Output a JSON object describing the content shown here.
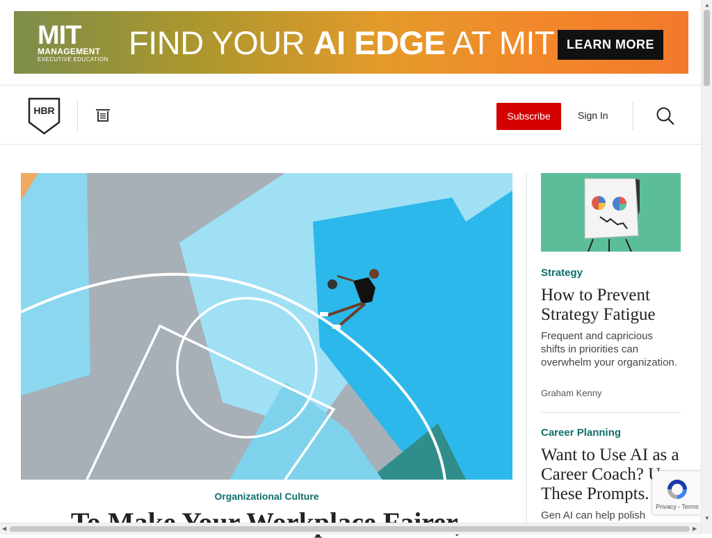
{
  "ad": {
    "logo_mit": "MIT",
    "logo_management": "MANAGEMENT",
    "logo_exec": "EXECUTIVE EDUCATION",
    "headline_prefix": "FIND YOUR ",
    "headline_bold": "AI EDGE",
    "headline_suffix": " AT MIT",
    "cta": "LEARN MORE"
  },
  "header": {
    "logo_text": "HBR",
    "subscribe_label": "Subscribe",
    "signin_label": "Sign In",
    "accent_color": "#d50000"
  },
  "main_article": {
    "category": "Organizational Culture",
    "title": "To Make Your Workplace Fairer,"
  },
  "sidebar": {
    "articles": [
      {
        "category": "Strategy",
        "title": "How to Prevent Strategy Fatigue",
        "description": "Frequent and capricious shifts in priorities can overwhelm your organization.",
        "author": "Graham Kenny"
      },
      {
        "category": "Career Planning",
        "title": "Want to Use AI as a Career Coach? Use These Prompts.",
        "description": "Gen AI can help polish"
      }
    ]
  },
  "recaptcha": {
    "terms_text": "Privacy - Terms"
  },
  "icons": {
    "menu": "menu-icon",
    "search": "search-icon"
  },
  "colors": {
    "category_teal": "#0f6e6e",
    "thumb_green": "#5bbe98"
  }
}
